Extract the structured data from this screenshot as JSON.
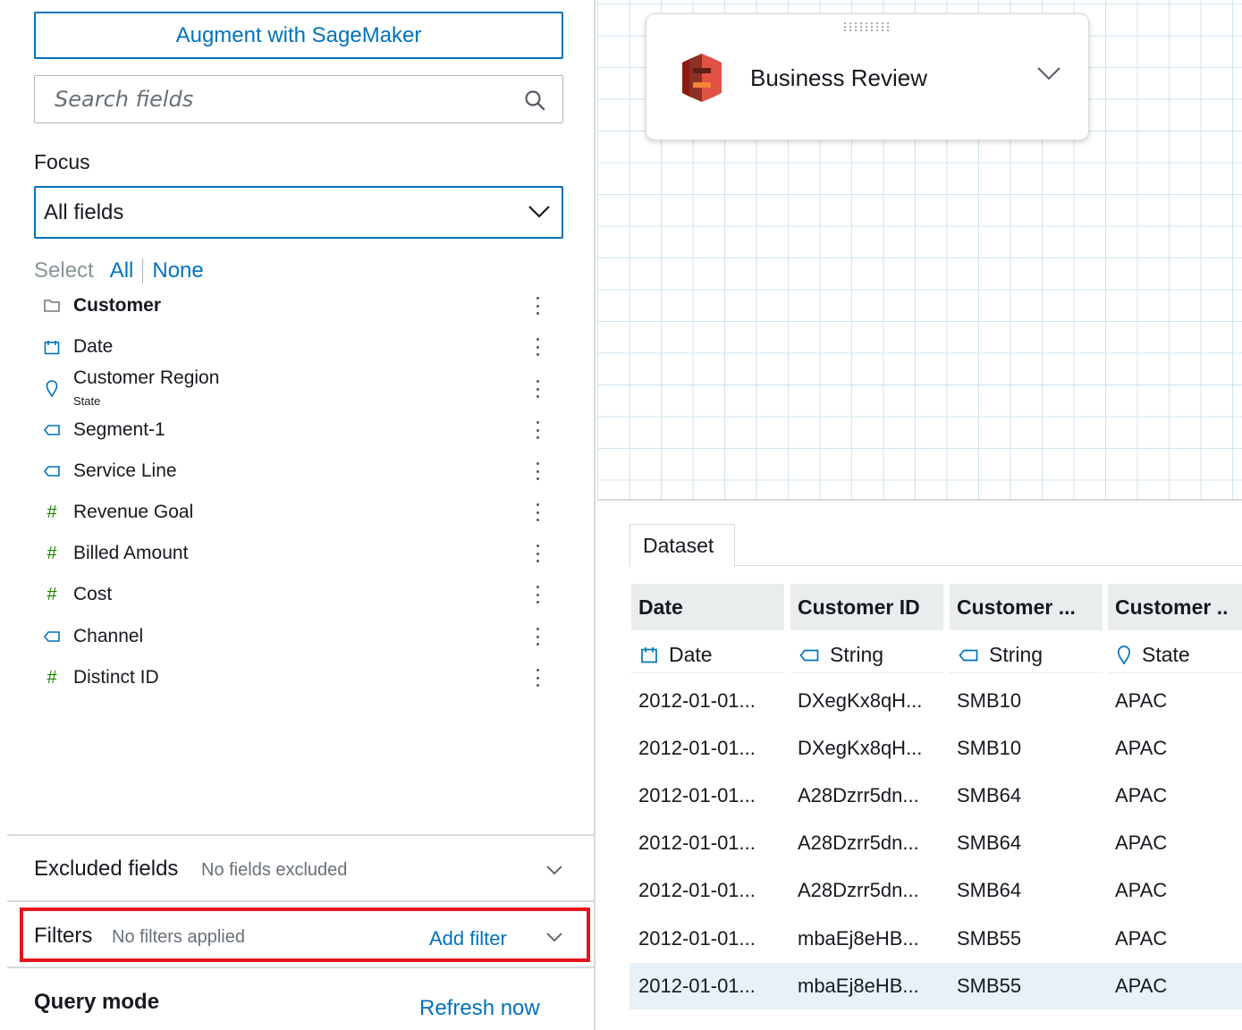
{
  "left_panel": {
    "augment_label": "Augment with SageMaker",
    "search": {
      "placeholder": "Search fields",
      "value": ""
    },
    "focus": {
      "label": "Focus",
      "selected": "All fields"
    },
    "select": {
      "label": "Select",
      "all": "All",
      "none": "None"
    },
    "fields": [
      {
        "name": "Customer",
        "icon": "folder-icon",
        "sub": ""
      },
      {
        "name": "Date",
        "icon": "calendar-icon",
        "sub": ""
      },
      {
        "name": "Customer Region",
        "icon": "location-pin-icon",
        "sub": "State"
      },
      {
        "name": "Segment-1",
        "icon": "tag-icon",
        "sub": ""
      },
      {
        "name": "Service Line",
        "icon": "tag-icon",
        "sub": ""
      },
      {
        "name": "Revenue Goal",
        "icon": "hash-icon",
        "sub": ""
      },
      {
        "name": "Billed Amount",
        "icon": "hash-icon",
        "sub": ""
      },
      {
        "name": "Cost",
        "icon": "hash-icon",
        "sub": ""
      },
      {
        "name": "Channel",
        "icon": "tag-icon",
        "sub": ""
      },
      {
        "name": "Distinct ID",
        "icon": "hash-icon",
        "sub": ""
      }
    ],
    "excluded": {
      "title": "Excluded fields",
      "status": "No fields excluded"
    },
    "filters": {
      "title": "Filters",
      "status": "No filters applied",
      "add_label": "Add filter"
    },
    "query_mode": {
      "title": "Query mode",
      "refresh_label": "Refresh now"
    }
  },
  "canvas": {
    "dataset_card": {
      "name": "Business Review",
      "icon": "s3-bucket-icon"
    }
  },
  "preview": {
    "tab_label": "Dataset",
    "columns": [
      {
        "header": "Date",
        "type": "Date",
        "type_icon": "calendar-icon"
      },
      {
        "header": "Customer ID",
        "type": "String",
        "type_icon": "tag-icon"
      },
      {
        "header": "Customer ...",
        "type": "String",
        "type_icon": "tag-icon"
      },
      {
        "header": "Customer ..",
        "type": "State",
        "type_icon": "location-pin-icon"
      }
    ],
    "rows": [
      [
        "2012-01-01...",
        "DXegKx8qH...",
        "SMB10",
        "APAC"
      ],
      [
        "2012-01-01...",
        "DXegKx8qH...",
        "SMB10",
        "APAC"
      ],
      [
        "2012-01-01...",
        "A28Dzrr5dn...",
        "SMB64",
        "APAC"
      ],
      [
        "2012-01-01...",
        "A28Dzrr5dn...",
        "SMB64",
        "APAC"
      ],
      [
        "2012-01-01...",
        "A28Dzrr5dn...",
        "SMB64",
        "APAC"
      ],
      [
        "2012-01-01...",
        "mbaEj8eHB...",
        "SMB55",
        "APAC"
      ],
      [
        "2012-01-01...",
        "mbaEj8eHB...",
        "SMB55",
        "APAC"
      ]
    ]
  },
  "colors": {
    "accent": "#0073bb",
    "measure": "#1d8102",
    "highlight_border": "#e4161b",
    "selected_row": "#e7f1f7",
    "s3_red": "#c7372f"
  }
}
